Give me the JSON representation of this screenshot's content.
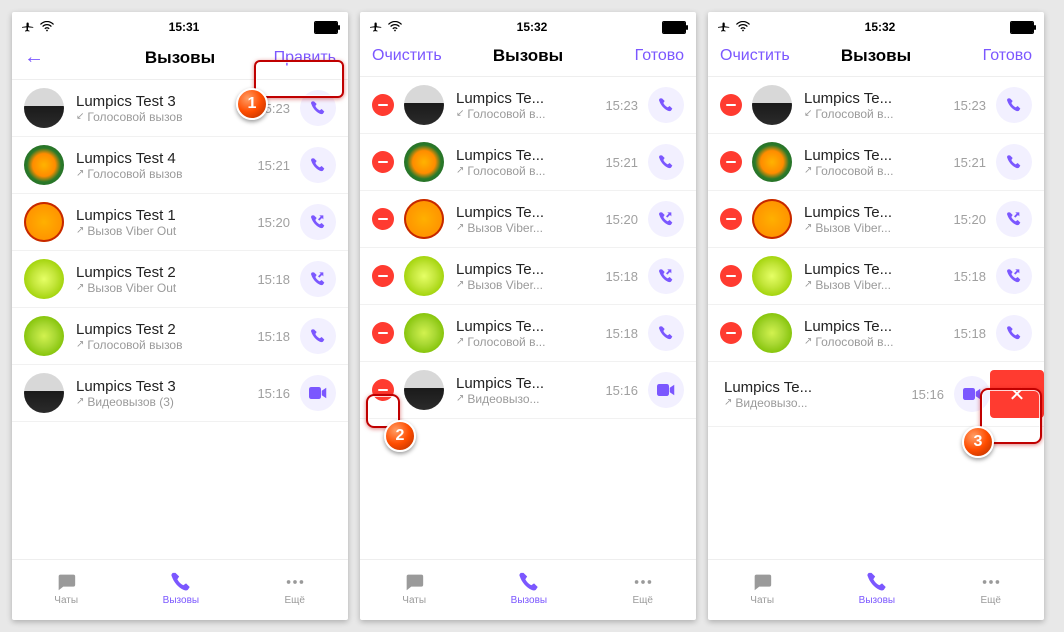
{
  "status_time": {
    "p1": "15:31",
    "p2": "15:32",
    "p3": "15:32"
  },
  "nav": {
    "title": "Вызовы",
    "edit": "Править",
    "clear": "Очистить",
    "done": "Готово"
  },
  "tabs": {
    "chats": "Чаты",
    "calls": "Вызовы",
    "more": "Ещё"
  },
  "calls_full": [
    {
      "name": "Lumpics Test 3",
      "sub": "Голосовой вызов",
      "dir": "↙",
      "time": "15:23",
      "icon": "phone",
      "avatar": "av-dark"
    },
    {
      "name": "Lumpics Test 4",
      "sub": "Голосовой вызов",
      "dir": "↗",
      "time": "15:21",
      "icon": "phone",
      "avatar": "av-orange"
    },
    {
      "name": "Lumpics Test 1",
      "sub": "Вызов Viber Out",
      "dir": "↗",
      "time": "15:20",
      "icon": "phone-out",
      "avatar": "av-citrus"
    },
    {
      "name": "Lumpics Test 2",
      "sub": "Вызов Viber Out",
      "dir": "↗",
      "time": "15:18",
      "icon": "phone-out",
      "avatar": "av-lime1"
    },
    {
      "name": "Lumpics Test 2",
      "sub": "Голосовой вызов",
      "dir": "↗",
      "time": "15:18",
      "icon": "phone",
      "avatar": "av-lime2"
    },
    {
      "name": "Lumpics Test 3",
      "sub": "Видеовызов (3)",
      "dir": "↗",
      "time": "15:16",
      "icon": "video",
      "avatar": "av-dark"
    }
  ],
  "calls_trunc": [
    {
      "name": "Lumpics Te...",
      "sub": "Голосовой в...",
      "dir": "↙",
      "time": "15:23",
      "icon": "phone",
      "avatar": "av-dark"
    },
    {
      "name": "Lumpics Te...",
      "sub": "Голосовой в...",
      "dir": "↗",
      "time": "15:21",
      "icon": "phone",
      "avatar": "av-orange"
    },
    {
      "name": "Lumpics Te...",
      "sub": "Вызов Viber...",
      "dir": "↗",
      "time": "15:20",
      "icon": "phone-out",
      "avatar": "av-citrus"
    },
    {
      "name": "Lumpics Te...",
      "sub": "Вызов Viber...",
      "dir": "↗",
      "time": "15:18",
      "icon": "phone-out",
      "avatar": "av-lime1"
    },
    {
      "name": "Lumpics Te...",
      "sub": "Голосовой в...",
      "dir": "↗",
      "time": "15:18",
      "icon": "phone",
      "avatar": "av-lime2"
    },
    {
      "name": "Lumpics Te...",
      "sub": "Видеовызо...",
      "dir": "↗",
      "time": "15:16",
      "icon": "video",
      "avatar": "av-dark"
    }
  ],
  "annotations": {
    "step1": "1",
    "step2": "2",
    "step3": "3"
  }
}
